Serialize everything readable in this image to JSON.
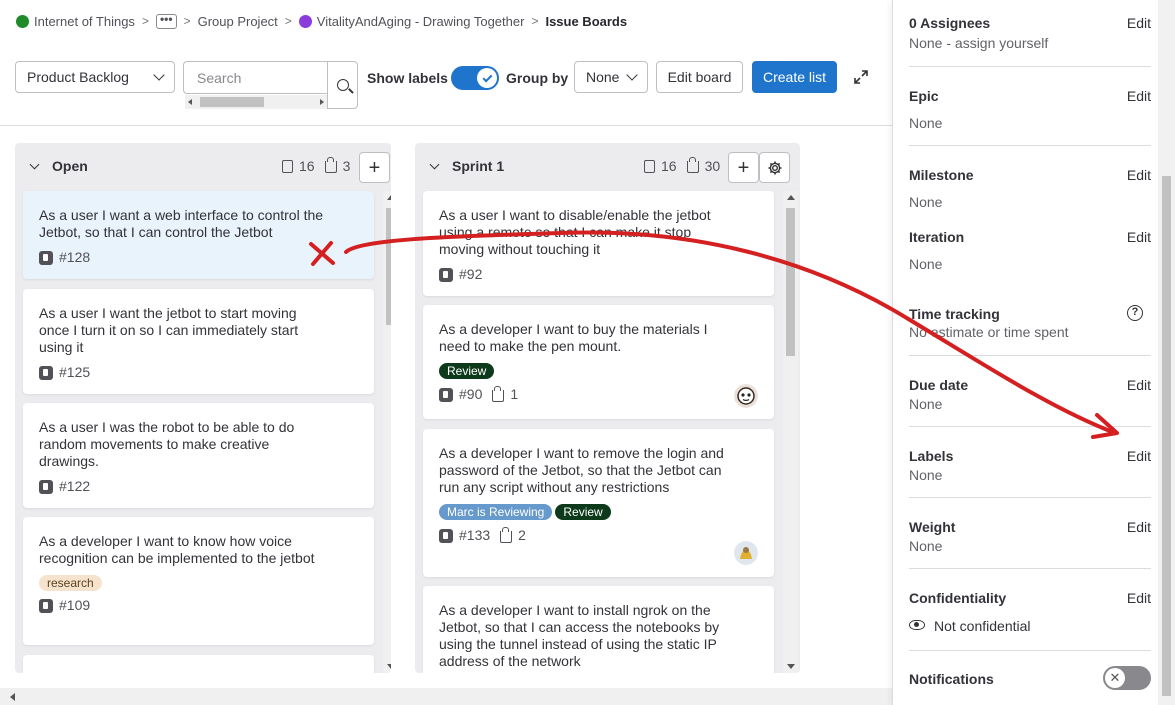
{
  "breadcrumb": {
    "items": [
      "Internet of Things",
      "•••",
      "Group Project",
      "VitalityAndAging - Drawing Together",
      "Issue Boards"
    ],
    "separator": ">"
  },
  "toolbar": {
    "board_select": "Product Backlog",
    "search_placeholder": "Search",
    "show_labels_label": "Show labels",
    "show_labels_on": true,
    "group_by_label": "Group by",
    "group_by_value": "None",
    "edit_board": "Edit board",
    "create_list": "Create list"
  },
  "lists": [
    {
      "title": "Open",
      "issue_count": "16",
      "weight": "3",
      "cards": [
        {
          "title": "As a user I want a web interface to control the Jetbot, so that I can control the Jetbot",
          "ref": "#128",
          "labels": [],
          "selected": true
        },
        {
          "title": "As a user I want the jetbot to start moving once I turn it on so I can immediately start using it",
          "ref": "#125",
          "labels": []
        },
        {
          "title": "As a user I was the robot to be able to do random movements to make creative drawings.",
          "ref": "#122",
          "labels": []
        },
        {
          "title": "As a developer I want to know how voice recognition can be implemented to the jetbot",
          "ref": "#109",
          "labels": [
            "research"
          ]
        }
      ]
    },
    {
      "title": "Sprint 1",
      "issue_count": "16",
      "weight": "30",
      "cards": [
        {
          "title": "As a user I want to disable/enable the jetbot using a remote so that I can make it stop moving without touching it",
          "ref": "#92",
          "labels": []
        },
        {
          "title": "As a developer I want to buy the materials I need to make the pen mount.",
          "ref": "#90",
          "weight": "1",
          "labels": [
            "Review"
          ]
        },
        {
          "title": "As a developer I want to remove the login and password of the Jetbot, so that the Jetbot can run any script without any restrictions",
          "ref": "#133",
          "weight": "2",
          "labels": [
            "Marc is Reviewing",
            "Review"
          ]
        },
        {
          "title": "As a developer I want to install ngrok on the Jetbot, so that I can access the notebooks by using the tunnel instead of using the static IP address of the network",
          "ref": "",
          "labels": []
        }
      ]
    }
  ],
  "sidebar": {
    "edit_label": "Edit",
    "assignees": {
      "title": "0 Assignees",
      "value": "None - assign yourself"
    },
    "epic": {
      "title": "Epic",
      "value": "None"
    },
    "milestone": {
      "title": "Milestone",
      "value": "None"
    },
    "iteration": {
      "title": "Iteration",
      "value": "None"
    },
    "time_tracking": {
      "title": "Time tracking",
      "value": "No estimate or time spent"
    },
    "due_date": {
      "title": "Due date",
      "value": "None"
    },
    "labels": {
      "title": "Labels",
      "value": "None"
    },
    "weight": {
      "title": "Weight",
      "value": "None"
    },
    "confidentiality": {
      "title": "Confidentiality",
      "value": "Not confidential"
    },
    "notifications": {
      "title": "Notifications",
      "on": false
    }
  },
  "colors": {
    "primary": "#1f75cb",
    "annotation_red": "#d42020",
    "review_label": "#0c3a1a",
    "research_label": "#f6e3cd",
    "marc_label": "#6699cc"
  }
}
